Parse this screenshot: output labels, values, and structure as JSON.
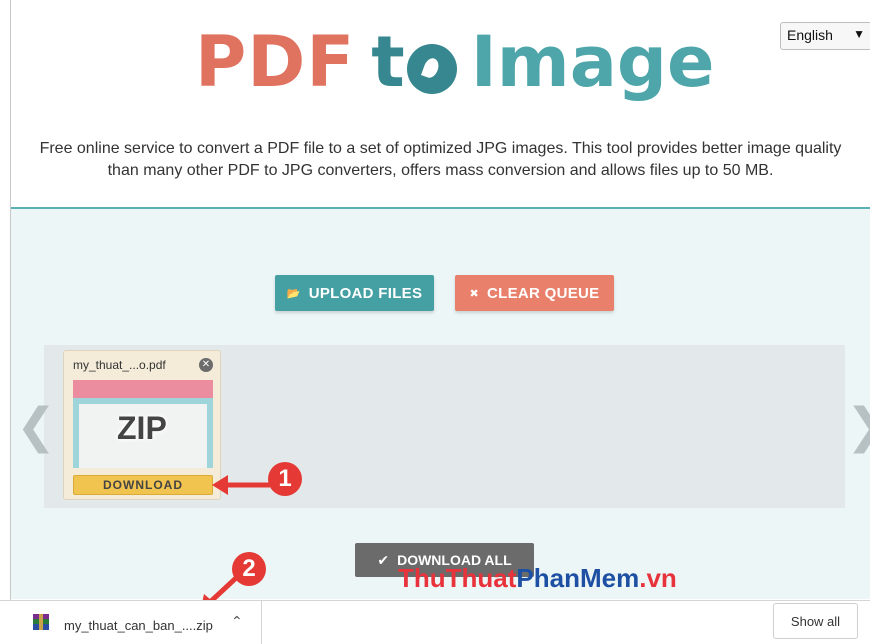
{
  "header": {
    "language": "English",
    "logo": {
      "part1": "PDF",
      "part2": "t",
      "part3": "Image"
    },
    "tagline_line1": "Free online service to convert a PDF file to a set of optimized JPG images. This tool provides better image quality",
    "tagline_line2": "than many other PDF to JPG converters, offers mass conversion and allows files up to 50 MB."
  },
  "toolbar": {
    "upload_label": "UPLOAD FILES",
    "clear_label": "CLEAR QUEUE"
  },
  "queue": {
    "file_name": "my_thuat_...o.pdf",
    "thumbnail_text": "ZIP",
    "download_label": "DOWNLOAD"
  },
  "download_all_label": "DOWNLOAD ALL",
  "callouts": {
    "one": "1",
    "two": "2"
  },
  "watermark": {
    "part1": "ThuThuat",
    "part2": "PhanMem",
    "part3": ".vn"
  },
  "download_bar": {
    "file_name": "my_thuat_can_ban_....zip",
    "show_all_label": "Show all"
  },
  "colors": {
    "accent_teal": "#45a0a3",
    "accent_coral": "#e8806b",
    "download_yellow": "#f1c44f",
    "callout_red": "#e53935"
  }
}
